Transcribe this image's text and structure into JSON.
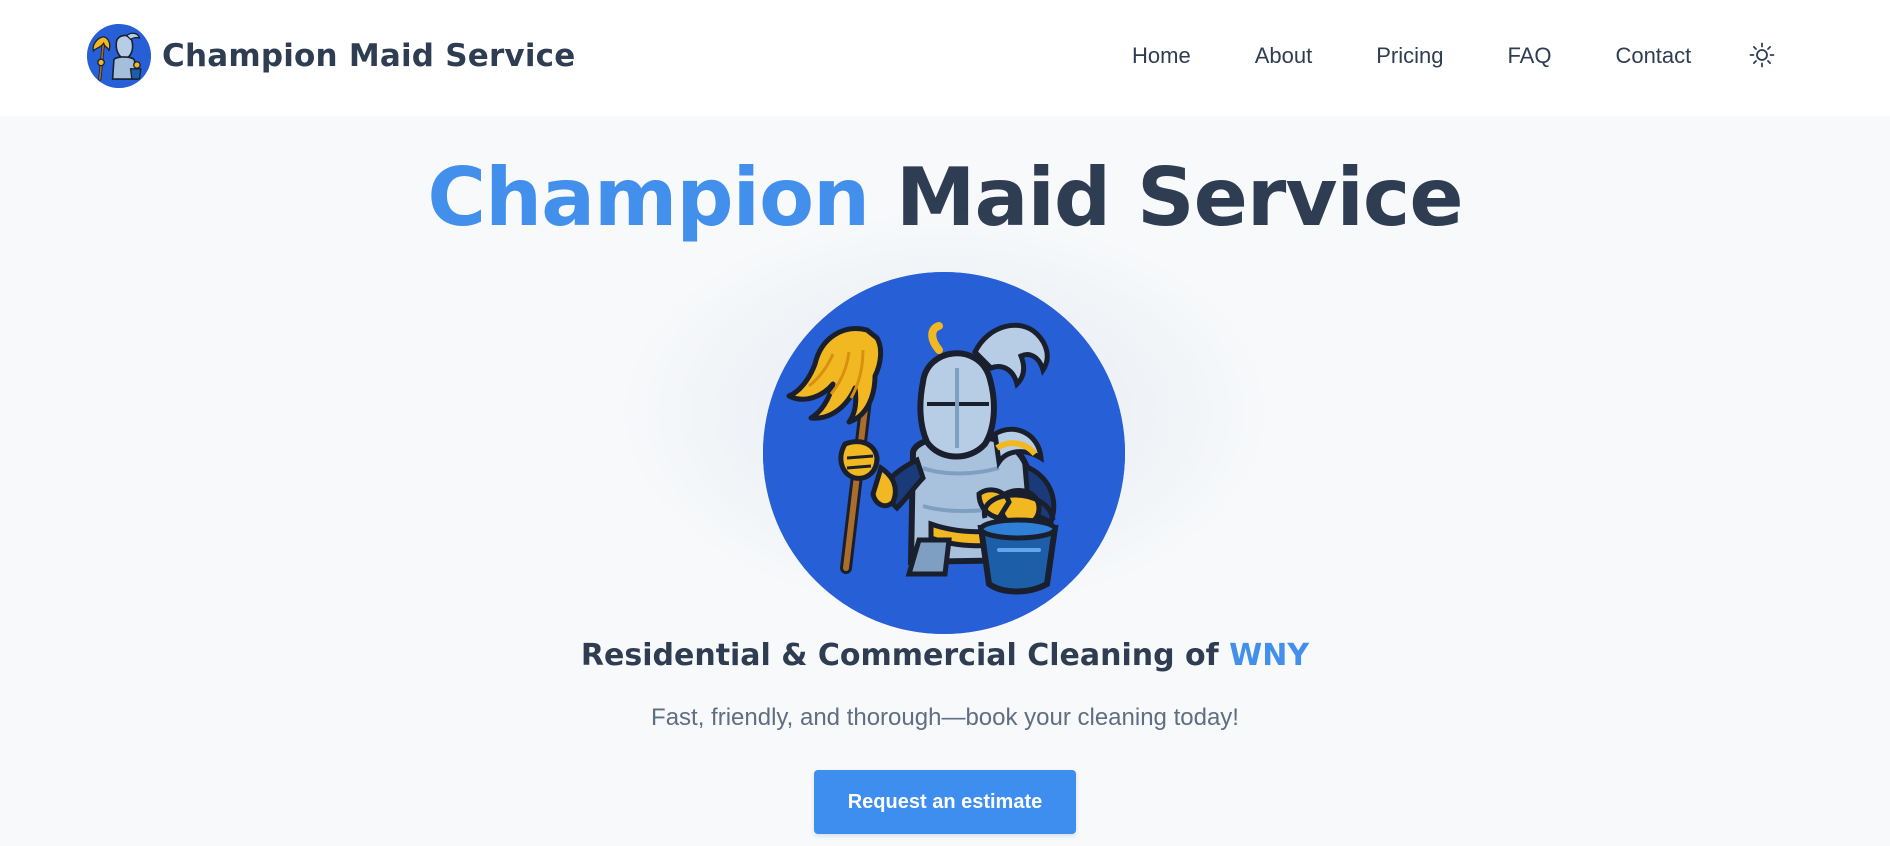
{
  "brand": {
    "name": "Champion Maid Service",
    "color": "#2760d6"
  },
  "nav": {
    "items": [
      {
        "label": "Home"
      },
      {
        "label": "About"
      },
      {
        "label": "Pricing"
      },
      {
        "label": "FAQ"
      },
      {
        "label": "Contact"
      }
    ],
    "theme_toggle_icon": "sun-icon"
  },
  "hero": {
    "title_accent": "Champion",
    "title_rest": "Maid Service",
    "mascot_icon": "knight-mascot-icon",
    "tagline_main": "Residential & Commercial Cleaning of ",
    "tagline_accent": "WNY",
    "subtitle": "Fast, friendly, and thorough—book your cleaning today!",
    "cta_label": "Request an estimate"
  },
  "colors": {
    "accent": "#4390ec",
    "text_dark": "#2f3d52",
    "text_muted": "#5f6e82",
    "button": "#3e8eef",
    "header_bg": "#ffffff",
    "page_bg": "#f7f9fb"
  }
}
